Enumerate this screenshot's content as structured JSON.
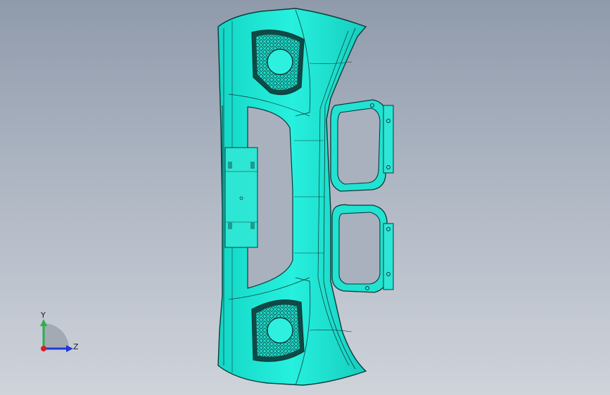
{
  "viewport": {
    "model_color": "#22e8d8",
    "edge_color": "#0b3a38",
    "background_top": "#8f9aab",
    "background_bottom": "#cfd3da"
  },
  "triad": {
    "y_label": "Y",
    "z_label": "Z",
    "y_color": "#2ab04a",
    "z_color": "#1f3ad8",
    "x_color": "#d42020"
  }
}
